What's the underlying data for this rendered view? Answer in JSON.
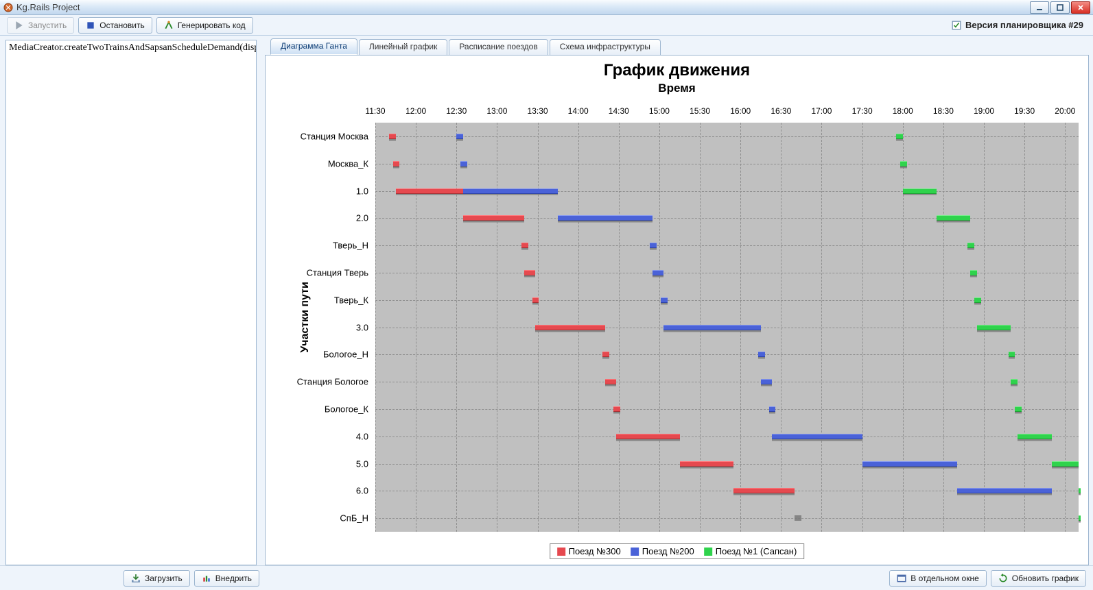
{
  "titlebar": {
    "title": "Kg.Rails Project"
  },
  "toolbar": {
    "run_label": "Запустить",
    "stop_label": "Остановить",
    "generate_label": "Генерировать код",
    "planner_version_label": "Версия планировщика #29"
  },
  "left_panel": {
    "code_text": "MediaCreator.createTwoTrainsAndSapsanScheduleDemand(dispatcher);"
  },
  "tabs": [
    {
      "label": "Диаграмма Ганта",
      "active": true
    },
    {
      "label": "Линейный график",
      "active": false
    },
    {
      "label": "Расписание поездов",
      "active": false
    },
    {
      "label": "Схема инфраструктуры",
      "active": false
    }
  ],
  "bottom_buttons": {
    "load_label": "Загрузить",
    "deploy_label": "Внедрить",
    "window_label": "В отдельном окне",
    "refresh_label": "Обновить график"
  },
  "chart_data": {
    "type": "gantt",
    "title": "График движения",
    "xlabel": "Время",
    "ylabel": "Участки пути",
    "x_range_minutes": [
      690,
      1210
    ],
    "x_ticks": [
      "11:30",
      "12:00",
      "12:30",
      "13:00",
      "13:30",
      "14:00",
      "14:30",
      "15:00",
      "15:30",
      "16:00",
      "16:30",
      "17:00",
      "17:30",
      "18:00",
      "18:30",
      "19:00",
      "19:30",
      "20:00"
    ],
    "y_categories": [
      "Станция Москва",
      "Москва_К",
      "1.0",
      "2.0",
      "Тверь_Н",
      "Станция Тверь",
      "Тверь_К",
      "3.0",
      "Бологое_Н",
      "Станция Бологое",
      "Бологое_К",
      "4.0",
      "5.0",
      "6.0",
      "СпБ_Н"
    ],
    "series": [
      {
        "name": "Поезд №300",
        "color": "#e6494f",
        "bars": [
          {
            "cat": "Станция Москва",
            "start": 700,
            "end": 705
          },
          {
            "cat": "Москва_К",
            "start": 703,
            "end": 708
          },
          {
            "cat": "1.0",
            "start": 705,
            "end": 755
          },
          {
            "cat": "2.0",
            "start": 755,
            "end": 800
          },
          {
            "cat": "Тверь_Н",
            "start": 798,
            "end": 803
          },
          {
            "cat": "Станция Тверь",
            "start": 800,
            "end": 808
          },
          {
            "cat": "Тверь_К",
            "start": 806,
            "end": 811
          },
          {
            "cat": "3.0",
            "start": 808,
            "end": 860
          },
          {
            "cat": "Бологое_Н",
            "start": 858,
            "end": 863
          },
          {
            "cat": "Станция Бологое",
            "start": 860,
            "end": 868
          },
          {
            "cat": "Бологое_К",
            "start": 866,
            "end": 871
          },
          {
            "cat": "4.0",
            "start": 868,
            "end": 915
          },
          {
            "cat": "5.0",
            "start": 915,
            "end": 955
          },
          {
            "cat": "6.0",
            "start": 955,
            "end": 1000
          }
        ]
      },
      {
        "name": "Поезд №200",
        "color": "#4a62d8",
        "bars": [
          {
            "cat": "Станция Москва",
            "start": 750,
            "end": 755
          },
          {
            "cat": "Москва_К",
            "start": 753,
            "end": 758
          },
          {
            "cat": "1.0",
            "start": 755,
            "end": 825
          },
          {
            "cat": "2.0",
            "start": 825,
            "end": 895
          },
          {
            "cat": "Тверь_Н",
            "start": 893,
            "end": 898
          },
          {
            "cat": "Станция Тверь",
            "start": 895,
            "end": 903
          },
          {
            "cat": "Тверь_К",
            "start": 901,
            "end": 906
          },
          {
            "cat": "3.0",
            "start": 903,
            "end": 975
          },
          {
            "cat": "Бологое_Н",
            "start": 973,
            "end": 978
          },
          {
            "cat": "Станция Бологое",
            "start": 975,
            "end": 983
          },
          {
            "cat": "Бологое_К",
            "start": 981,
            "end": 986
          },
          {
            "cat": "4.0",
            "start": 983,
            "end": 1050
          },
          {
            "cat": "5.0",
            "start": 1050,
            "end": 1120
          },
          {
            "cat": "6.0",
            "start": 1120,
            "end": 1190
          }
        ]
      },
      {
        "name": "Поезд №1 (Сапсан)",
        "color": "#2fd34c",
        "bars": [
          {
            "cat": "Станция Москва",
            "start": 1075,
            "end": 1080
          },
          {
            "cat": "Москва_К",
            "start": 1078,
            "end": 1083
          },
          {
            "cat": "1.0",
            "start": 1080,
            "end": 1105
          },
          {
            "cat": "2.0",
            "start": 1105,
            "end": 1130
          },
          {
            "cat": "Тверь_Н",
            "start": 1128,
            "end": 1133
          },
          {
            "cat": "Станция Тверь",
            "start": 1130,
            "end": 1135
          },
          {
            "cat": "Тверь_К",
            "start": 1133,
            "end": 1138
          },
          {
            "cat": "3.0",
            "start": 1135,
            "end": 1160
          },
          {
            "cat": "Бологое_Н",
            "start": 1158,
            "end": 1163
          },
          {
            "cat": "Станция Бологое",
            "start": 1160,
            "end": 1165
          },
          {
            "cat": "Бологое_К",
            "start": 1163,
            "end": 1168
          },
          {
            "cat": "4.0",
            "start": 1165,
            "end": 1190
          },
          {
            "cat": "5.0",
            "start": 1190,
            "end": 1215
          },
          {
            "cat": "6.0",
            "start": 1215,
            "end": 1240
          },
          {
            "cat": "СпБ_Н",
            "start": 1238,
            "end": 1243
          }
        ]
      }
    ],
    "shadows": [
      {
        "cat": "СпБ_Н",
        "start": 1000,
        "end": 1005
      }
    ]
  }
}
